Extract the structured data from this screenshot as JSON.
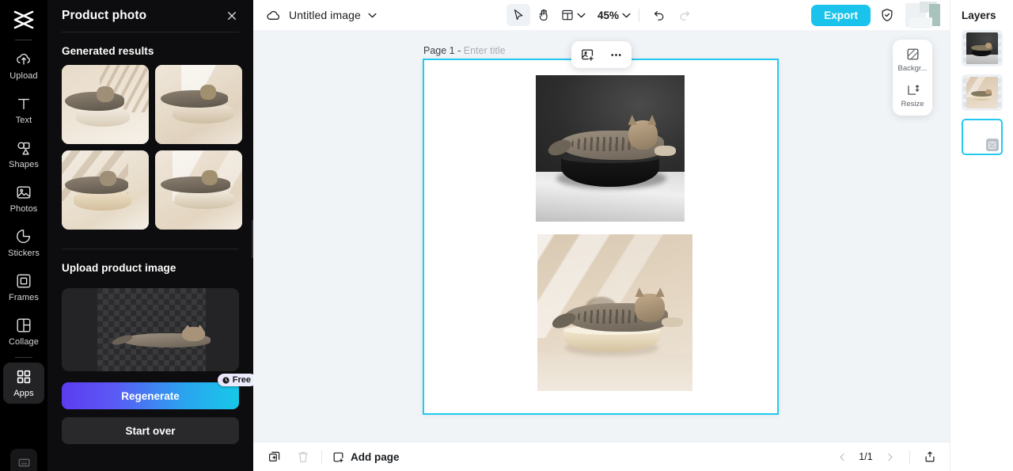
{
  "theme": {
    "accent": "#22c9f0",
    "export_bg": "#19c3eb",
    "panel_bg": "#0d0d0f",
    "rail_bg": "#000000"
  },
  "rail": {
    "logo_name": "capcut-logo",
    "items": [
      {
        "label": "Upload",
        "icon": "upload-cloud-icon",
        "active": false
      },
      {
        "label": "Text",
        "icon": "text-icon",
        "active": false
      },
      {
        "label": "Shapes",
        "icon": "shapes-icon",
        "active": false
      },
      {
        "label": "Photos",
        "icon": "photos-icon",
        "active": false
      },
      {
        "label": "Stickers",
        "icon": "stickers-icon",
        "active": false
      },
      {
        "label": "Frames",
        "icon": "frames-icon",
        "active": false
      },
      {
        "label": "Collage",
        "icon": "collage-icon",
        "active": false
      },
      {
        "label": "Apps",
        "icon": "apps-grid-icon",
        "active": true
      }
    ],
    "bottom_icon": "keyboard-icon"
  },
  "panel": {
    "title": "Product photo",
    "close_icon": "close-icon",
    "generated_section_title": "Generated results",
    "results": [
      {
        "name": "generated-result-1"
      },
      {
        "name": "generated-result-2"
      },
      {
        "name": "generated-result-3"
      },
      {
        "name": "generated-result-4"
      }
    ],
    "upload_section_title": "Upload product image",
    "upload_preview_name": "product-cutout-preview",
    "regenerate_label": "Regenerate",
    "free_badge_label": "Free",
    "start_over_label": "Start over",
    "collapse_icon": "chevron-left-icon"
  },
  "topbar": {
    "cloud_icon": "cloud-saved-icon",
    "doc_title": "Untitled image",
    "doc_caret_icon": "chevron-down-icon",
    "tools": [
      {
        "name": "select-tool",
        "icon": "cursor-arrow-icon",
        "active": true
      },
      {
        "name": "hand-tool",
        "icon": "hand-icon",
        "active": false
      },
      {
        "name": "layout-tool",
        "icon": "layout-grid-icon",
        "active": false
      }
    ],
    "zoom_value": "45%",
    "zoom_caret_icon": "chevron-down-icon",
    "undo_icon": "undo-icon",
    "redo_icon": "redo-icon",
    "export_label": "Export",
    "shield_icon": "shield-check-icon",
    "avatar_name": "user-avatar"
  },
  "canvas": {
    "page_label": "Page 1 -",
    "title_placeholder": "Enter title",
    "float_toolbar": [
      {
        "name": "add-image-button",
        "icon": "add-image-icon"
      },
      {
        "name": "more-options-button",
        "icon": "ellipsis-icon"
      }
    ],
    "side_tools": [
      {
        "label": "Backgr...",
        "icon": "background-icon",
        "name": "background-tool"
      },
      {
        "label": "Resize",
        "icon": "resize-icon",
        "name": "resize-tool"
      }
    ],
    "images": [
      {
        "name": "canvas-image-dark-podium-cat"
      },
      {
        "name": "canvas-image-cream-podium-cat"
      }
    ]
  },
  "bottombar": {
    "duplicate_icon": "duplicate-page-icon",
    "delete_icon": "trash-icon",
    "add_page_label": "Add page",
    "add_page_icon": "add-page-icon",
    "prev_icon": "chevron-left-icon",
    "page_indicator": "1/1",
    "next_icon": "chevron-right-icon",
    "export_icon": "export-upload-icon"
  },
  "layers": {
    "title": "Layers",
    "items": [
      {
        "name": "layer-dark-cat-image",
        "type": "image",
        "selected": false
      },
      {
        "name": "layer-cream-cat-image",
        "type": "image",
        "selected": false
      },
      {
        "name": "layer-background",
        "type": "background",
        "selected": true
      }
    ]
  }
}
